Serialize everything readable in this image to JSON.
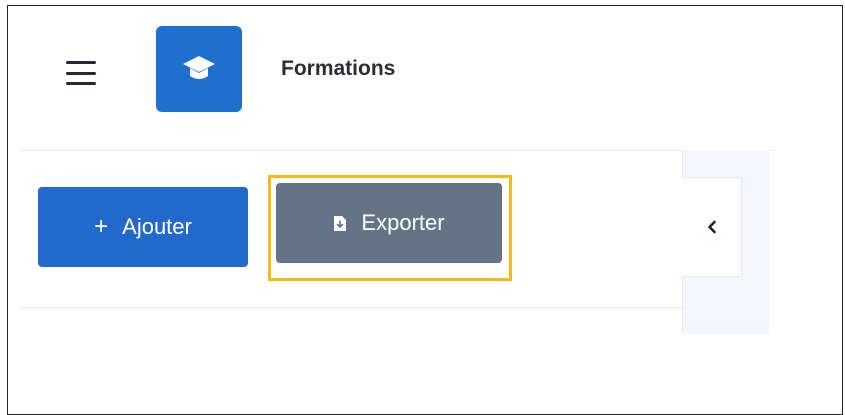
{
  "header": {
    "menu_icon": "hamburger-icon",
    "logo_icon": "graduation-cap-icon",
    "title": "Formations"
  },
  "toolbar": {
    "add_button": {
      "icon": "plus-icon",
      "label": "Ajouter"
    },
    "export_button": {
      "icon": "file-export-icon",
      "label": "Exporter"
    }
  },
  "side_panel": {
    "toggle_icon": "chevron-left-icon"
  },
  "colors": {
    "primary": "#2369cc",
    "logo_bg": "#1f6fcf",
    "secondary": "#647387",
    "highlight": "#f2bb1b",
    "panel_bg": "#f3f6fa"
  }
}
